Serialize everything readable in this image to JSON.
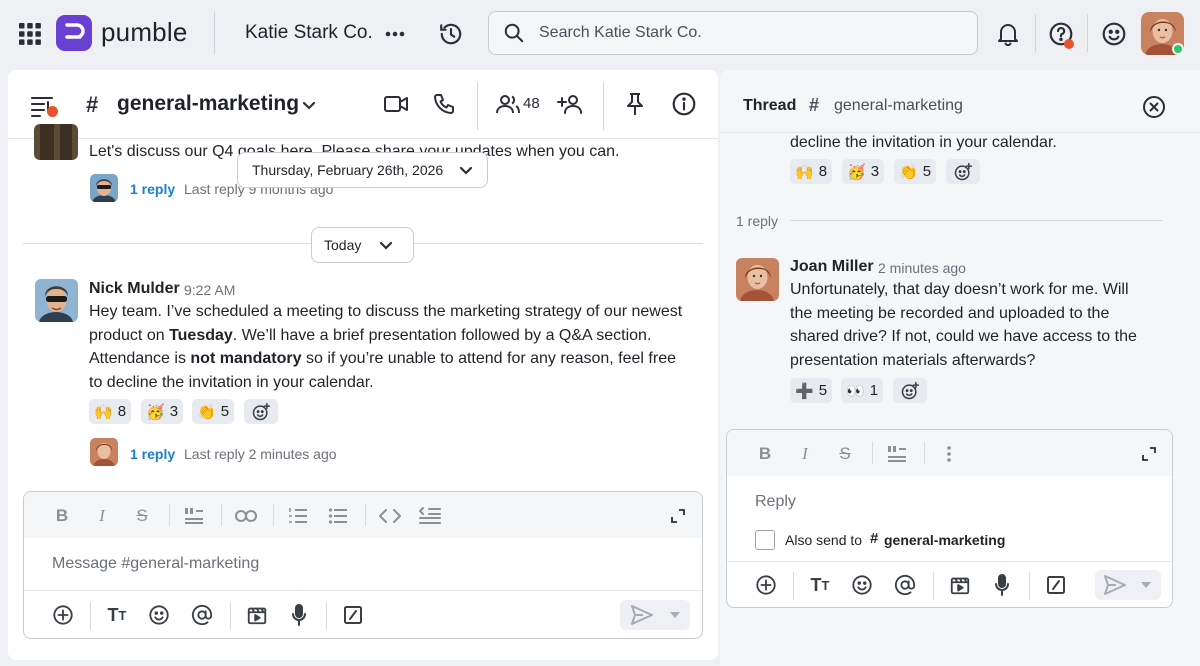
{
  "app": {
    "brand": "pumble",
    "workspace": "Katie Stark Co."
  },
  "search": {
    "placeholder": "Search Katie Stark Co."
  },
  "channel": {
    "hash": "#",
    "name": "general-marketing",
    "member_count": "48"
  },
  "earlier_message": {
    "text": "Let's discuss our Q4 goals here. Please share your updates when you can.",
    "reply_count": "1 reply",
    "last_reply": "Last reply 9 months ago"
  },
  "date_chip": {
    "label": "Thursday, February 26th, 2026"
  },
  "today_chip": {
    "label": "Today"
  },
  "message": {
    "author": "Nick Mulder",
    "time": "9:22 AM",
    "text_parts": {
      "p1": "Hey team. I’ve scheduled a meeting to discuss the marketing strategy of our newest product on ",
      "b1": "Tuesday",
      "p2": ". We’ll have a brief presentation followed by a Q&A section. Attendance is ",
      "b2": "not mandatory",
      "p3": " so if you’re unable to attend for any reason, feel free to decline the invitation in your calendar."
    },
    "reactions": [
      {
        "emoji": "🙌",
        "count": "8"
      },
      {
        "emoji": "🥳",
        "count": "3"
      },
      {
        "emoji": "👏",
        "count": "5"
      }
    ],
    "reply_count": "1 reply",
    "last_reply": "Last reply 2 minutes ago"
  },
  "composer": {
    "placeholder": "Message #general-marketing"
  },
  "thread": {
    "title": "Thread",
    "channel_hash": "#",
    "channel": "general-marketing",
    "parent_tail": "decline the invitation in your calendar.",
    "parent_reactions": [
      {
        "emoji": "🙌",
        "count": "8"
      },
      {
        "emoji": "🥳",
        "count": "3"
      },
      {
        "emoji": "👏",
        "count": "5"
      }
    ],
    "reply_divider": "1 reply",
    "reply": {
      "author": "Joan Miller",
      "time": "2 minutes ago",
      "lines": [
        "Unfortunately, that day doesn’t work for me. Will",
        "the meeting be recorded and uploaded to the",
        "shared drive? If not, could we have access to the",
        "presentation materials afterwards?"
      ],
      "reactions": [
        {
          "emoji": "➕",
          "count": "5"
        },
        {
          "emoji": "👀",
          "count": "1"
        }
      ]
    },
    "composer_placeholder": "Reply",
    "also_send_label": "Also send to",
    "also_send_hash": "#",
    "also_send_channel": "general-marketing"
  },
  "colors": {
    "brand": "#6a3fd4",
    "link": "#1a7fd1",
    "notification_dot": "#e5532d",
    "online": "#33c46b"
  }
}
